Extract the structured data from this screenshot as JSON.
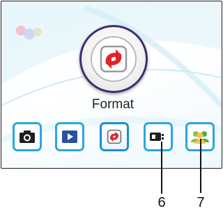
{
  "screen": {
    "mode_label": "Format",
    "current_icon": "format-icon"
  },
  "toolbar": {
    "items": [
      {
        "name": "camera-mode",
        "icon": "camera-icon"
      },
      {
        "name": "playback-mode",
        "icon": "playback-icon"
      },
      {
        "name": "format-mode",
        "icon": "format-icon",
        "active": true
      },
      {
        "name": "usb-mode",
        "icon": "usb-icon"
      },
      {
        "name": "users-mode",
        "icon": "users-icon"
      }
    ]
  },
  "callouts": [
    {
      "label": "6",
      "target": "usb-mode"
    },
    {
      "label": "7",
      "target": "users-mode"
    }
  ],
  "colors": {
    "button_border": "#2aa6df",
    "icon_frame": "#3a2f6e",
    "format_arrows": "#e0242c",
    "playback_blue": "#2d4fa3",
    "users_green": "#59b33a"
  }
}
